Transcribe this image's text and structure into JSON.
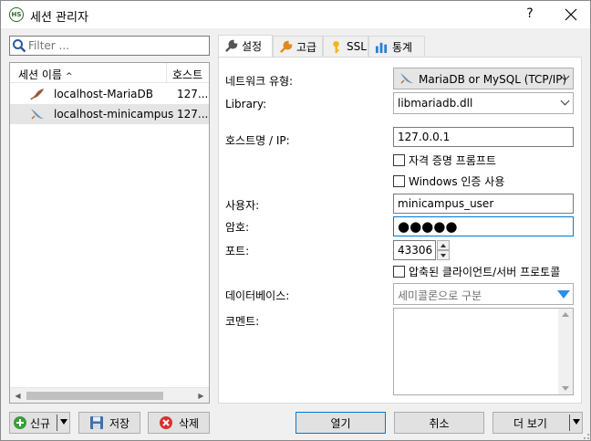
{
  "window": {
    "title": "세션 관리자",
    "app_icon_text": "HS"
  },
  "filter": {
    "placeholder": "Filter ..."
  },
  "session_list": {
    "columns": [
      "세션 이름",
      "호스트"
    ],
    "rows": [
      {
        "name": "localhost-MariaDB",
        "host": "127...."
      },
      {
        "name": "localhost-minicampus",
        "host": "127...."
      }
    ]
  },
  "left_buttons": {
    "new": "신규",
    "save": "저장",
    "delete": "삭제"
  },
  "tabs": [
    "설정",
    "고급",
    "SSL",
    "통계"
  ],
  "settings": {
    "network_type_label": "네트워크 유형:",
    "network_type_value": "MariaDB or MySQL (TCP/IP)",
    "library_label": "Library:",
    "library_value": "libmariadb.dll",
    "host_label": "호스트명 / IP:",
    "host_value": "127.0.0.1",
    "prompt_credentials": "자격 증명 프롬프트",
    "windows_auth": "Windows 인증 사용",
    "user_label": "사용자:",
    "user_value": "minicampus_user",
    "password_label": "암호:",
    "password_value": "●●●●●",
    "port_label": "포트:",
    "port_value": "43306",
    "compressed": "압축된 클라이언트/서버 프로토콜",
    "database_label": "데이터베이스:",
    "database_placeholder": "세미콜론으로 구분",
    "comment_label": "코멘트:"
  },
  "bottom_buttons": {
    "open": "열기",
    "cancel": "취소",
    "more": "더 보기"
  },
  "colors": {
    "accent": "#0078d7",
    "selected_row": "#e5e5e5",
    "dropdown_arrow": "#2d8ee8"
  }
}
